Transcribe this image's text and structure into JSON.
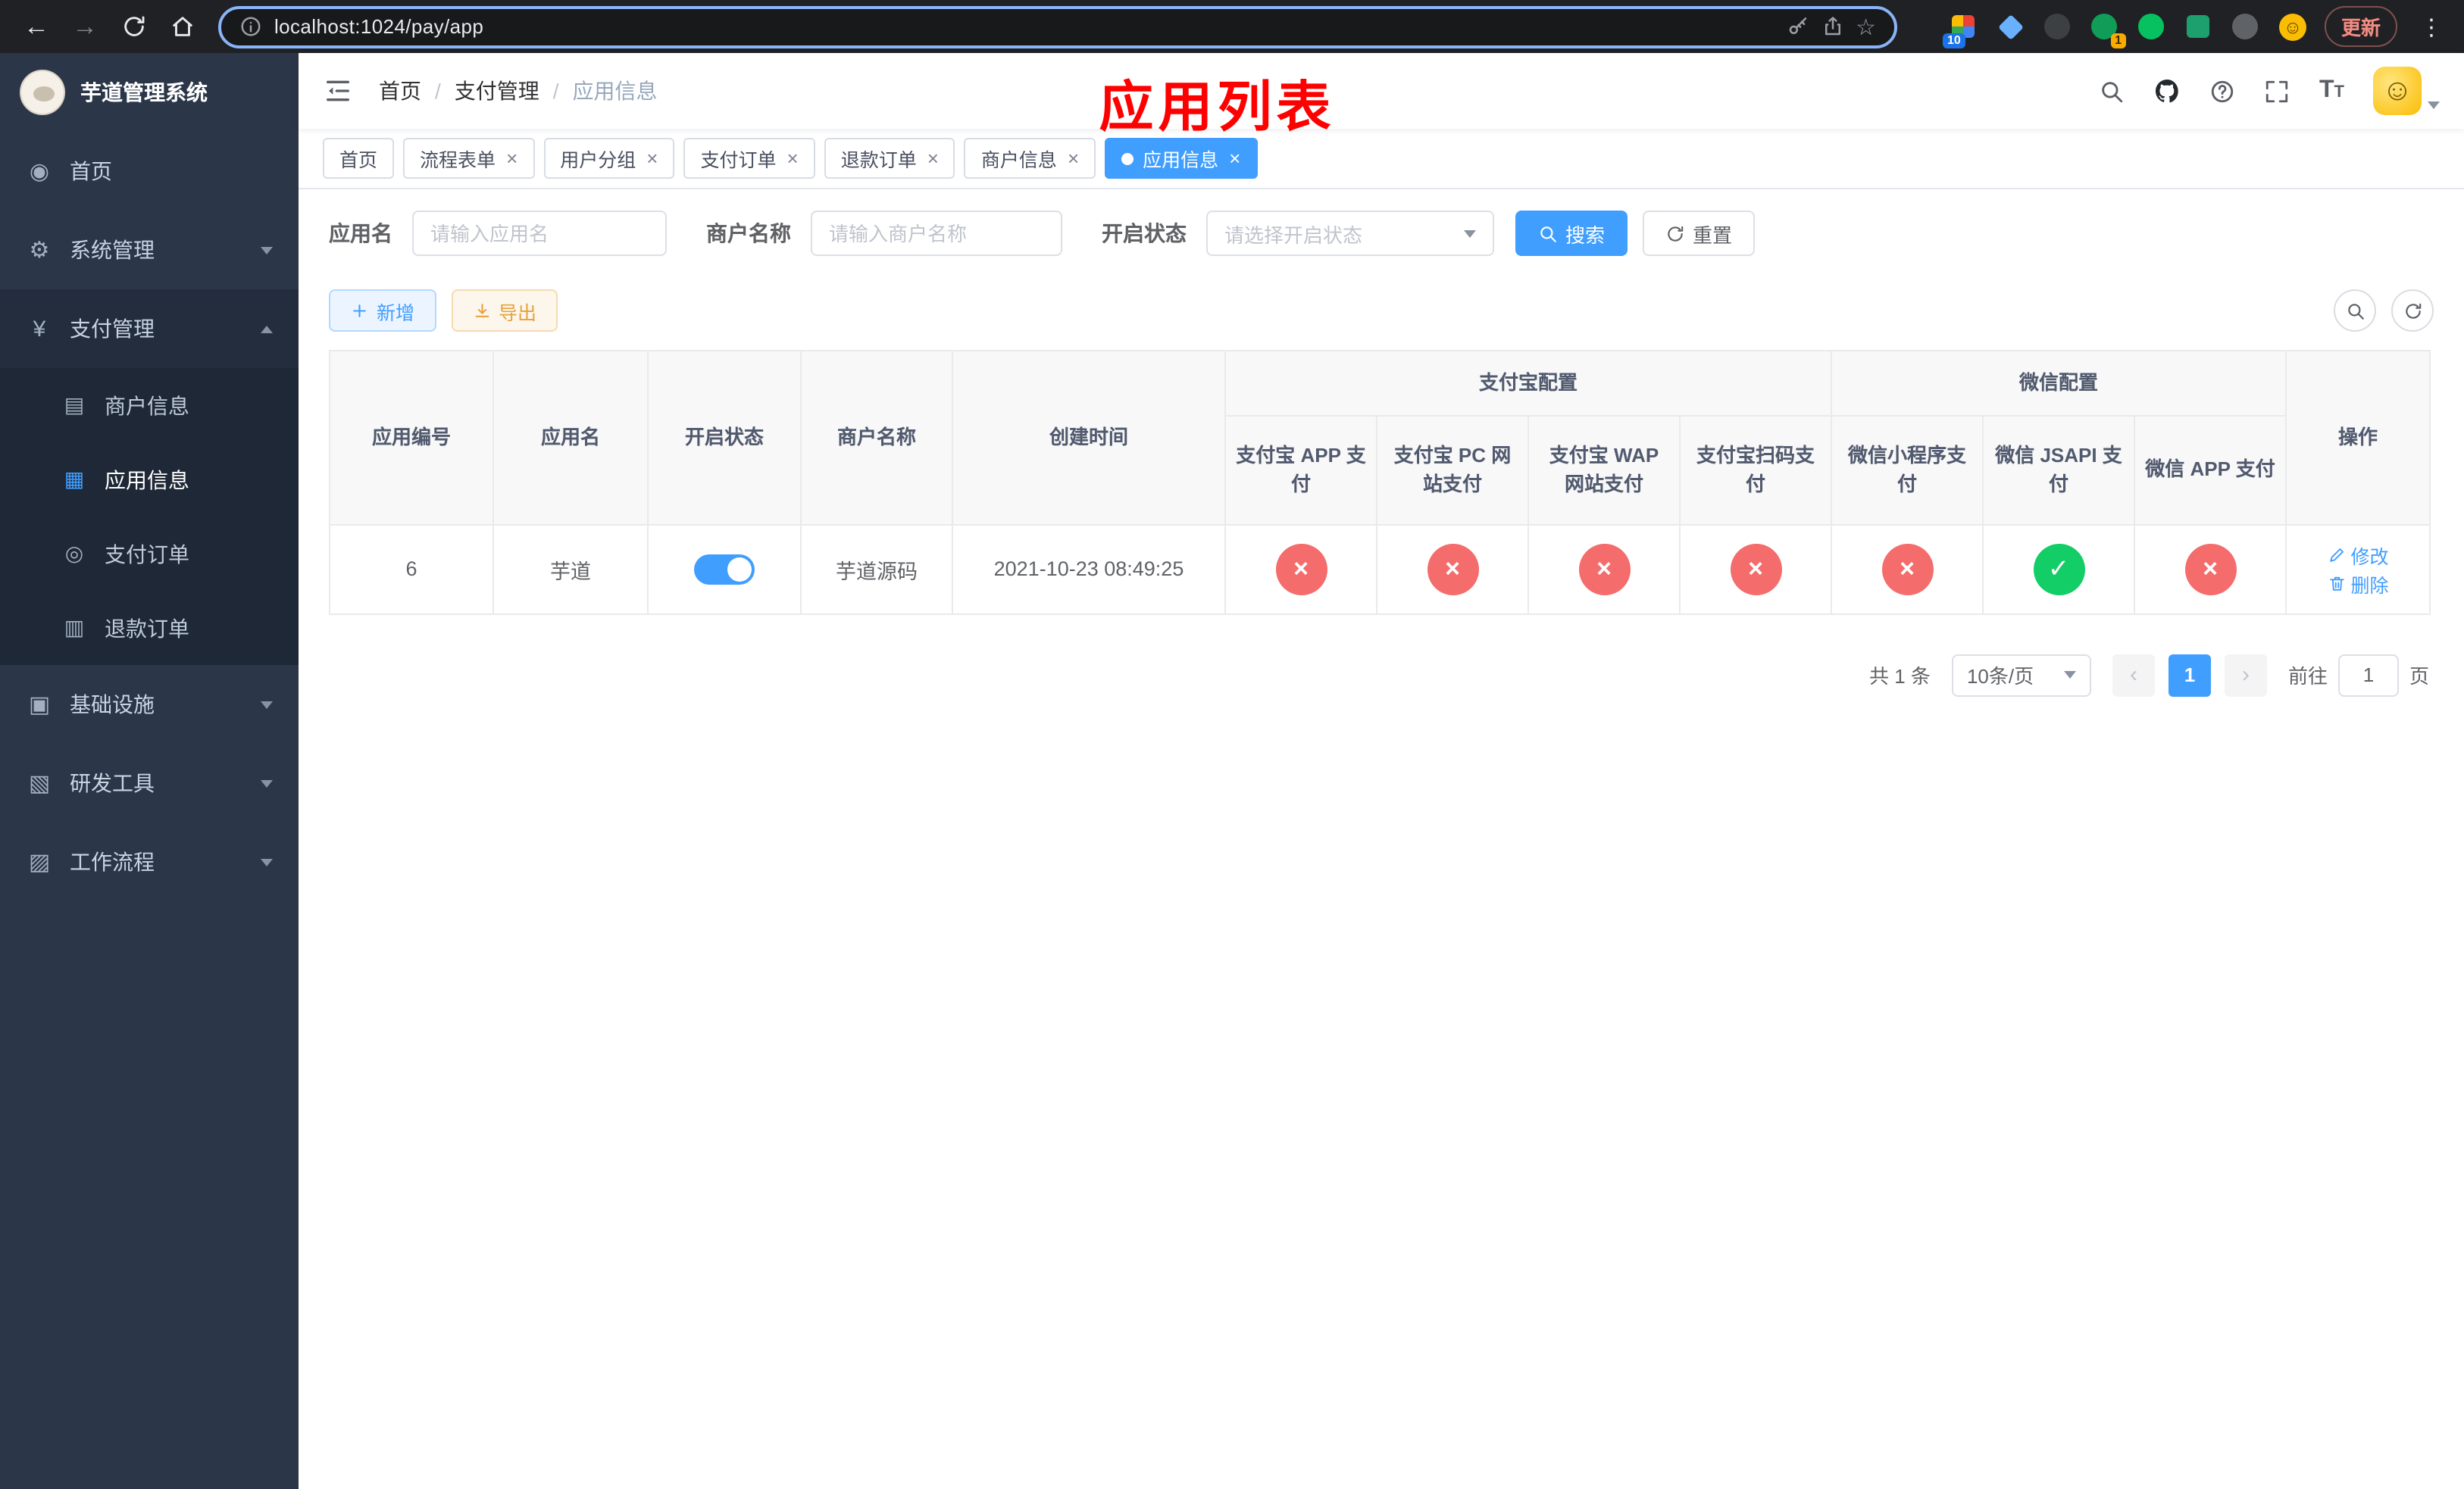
{
  "colors": {
    "accent": "#409eff",
    "success": "#13ce66",
    "danger": "#f56c6c",
    "warning": "#e6a23c",
    "sidebar_bg": "#2b3648",
    "chrome_bg": "#202124"
  },
  "browser": {
    "url": "localhost:1024/pay/app",
    "update_label": "更新",
    "extension_badge_10": "10",
    "extension_badge_1": "1"
  },
  "sidebar": {
    "title": "芋道管理系统",
    "menu": {
      "home": "首页",
      "system": "系统管理",
      "payment": "支付管理",
      "merchant_info": "商户信息",
      "app_info": "应用信息",
      "pay_order": "支付订单",
      "refund_order": "退款订单",
      "infra": "基础设施",
      "dev_tools": "研发工具",
      "workflow": "工作流程"
    }
  },
  "header": {
    "breadcrumb": [
      "首页",
      "支付管理",
      "应用信息"
    ],
    "overlay_title": "应用列表"
  },
  "tabs": {
    "items": [
      {
        "label": "首页",
        "closable": false,
        "active": false
      },
      {
        "label": "流程表单",
        "closable": true,
        "active": false
      },
      {
        "label": "用户分组",
        "closable": true,
        "active": false
      },
      {
        "label": "支付订单",
        "closable": true,
        "active": false
      },
      {
        "label": "退款订单",
        "closable": true,
        "active": false
      },
      {
        "label": "商户信息",
        "closable": true,
        "active": false
      },
      {
        "label": "应用信息",
        "closable": true,
        "active": true
      }
    ]
  },
  "filters": {
    "app_name_label": "应用名",
    "app_name_placeholder": "请输入应用名",
    "app_name_value": "",
    "merchant_label": "商户名称",
    "merchant_placeholder": "请输入商户名称",
    "merchant_value": "",
    "status_label": "开启状态",
    "status_placeholder": "请选择开启状态",
    "search_label": "搜索",
    "reset_label": "重置"
  },
  "toolbar": {
    "add_label": "新增",
    "export_label": "导出"
  },
  "table": {
    "headers": {
      "app_id": "应用编号",
      "app_name": "应用名",
      "status": "开启状态",
      "merchant_name": "商户名称",
      "create_time": "创建时间",
      "alipay_group": "支付宝配置",
      "wechat_group": "微信配置",
      "alipay_app": "支付宝 APP 支付",
      "alipay_pc": "支付宝 PC 网站支付",
      "alipay_wap": "支付宝 WAP 网站支付",
      "alipay_qr": "支付宝扫码支付",
      "wx_mini": "微信小程序支付",
      "wx_jsapi": "微信 JSAPI 支付",
      "wx_app": "微信 APP 支付",
      "actions": "操作"
    },
    "ops": {
      "edit": "修改",
      "delete": "删除"
    },
    "rows": [
      {
        "app_id": "6",
        "app_name": "芋道",
        "status_on": true,
        "merchant_name": "芋道源码",
        "create_time": "2021-10-23 08:49:25",
        "configs": {
          "alipay_app": false,
          "alipay_pc": false,
          "alipay_wap": false,
          "alipay_qr": false,
          "wx_mini": false,
          "wx_jsapi": true,
          "wx_app": false
        }
      }
    ]
  },
  "pagination": {
    "total": "共 1 条",
    "page_size": "10条/页",
    "current_page": "1",
    "goto_label": "前往",
    "goto_value": "1",
    "page_unit": "页"
  },
  "icons": [
    "back-icon",
    "forward-icon",
    "reload-icon",
    "home-icon",
    "info-icon",
    "key-icon",
    "share-icon",
    "star-icon",
    "search-icon",
    "github-icon",
    "help-icon",
    "fullscreen-icon",
    "font-size-icon",
    "hamburger-icon",
    "plus-icon",
    "download-icon",
    "refresh-icon",
    "edit-icon",
    "delete-icon",
    "close-tab-icon",
    "chevron-icons",
    "status-cross-icon",
    "status-check-icon"
  ]
}
